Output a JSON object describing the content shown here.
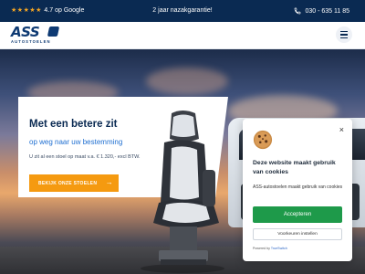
{
  "topbar": {
    "stars": 5,
    "rating_text": "4.7 op Google",
    "guarantee": "2 jaar nazakgarantie!",
    "phone": "030 - 635 11 85"
  },
  "header": {
    "logo_brand": "ASS",
    "logo_sub": "AUTOSTOELEN"
  },
  "hero": {
    "title": "Met een betere zit",
    "subtitle": "op weg naar uw bestemming",
    "price_line": "U zit al een stoel op maat v.a. € 1.320,- excl BTW.",
    "cta_label": "BEKIJK ONZE STOELEN",
    "cta_arrow": "→"
  },
  "cookie": {
    "close": "×",
    "title": "Deze website maakt gebruik van cookies",
    "description": "ASS-autostoelen maakt gebruik van cookies",
    "accept_label": "Accepteren",
    "prefs_label": "Voorkeuren instellen",
    "powered_prefix": "Powered by",
    "powered_link": "TrueSwitch"
  },
  "colors": {
    "navy": "#0a2a52",
    "accent_orange": "#f59a10",
    "accent_blue": "#1f6fd1",
    "accept_green": "#1e9a4a",
    "star": "#f5a623"
  },
  "icons": [
    "star-icon",
    "phone-icon",
    "menu-icon",
    "arrow-right-icon",
    "close-icon",
    "cookie-icon"
  ]
}
